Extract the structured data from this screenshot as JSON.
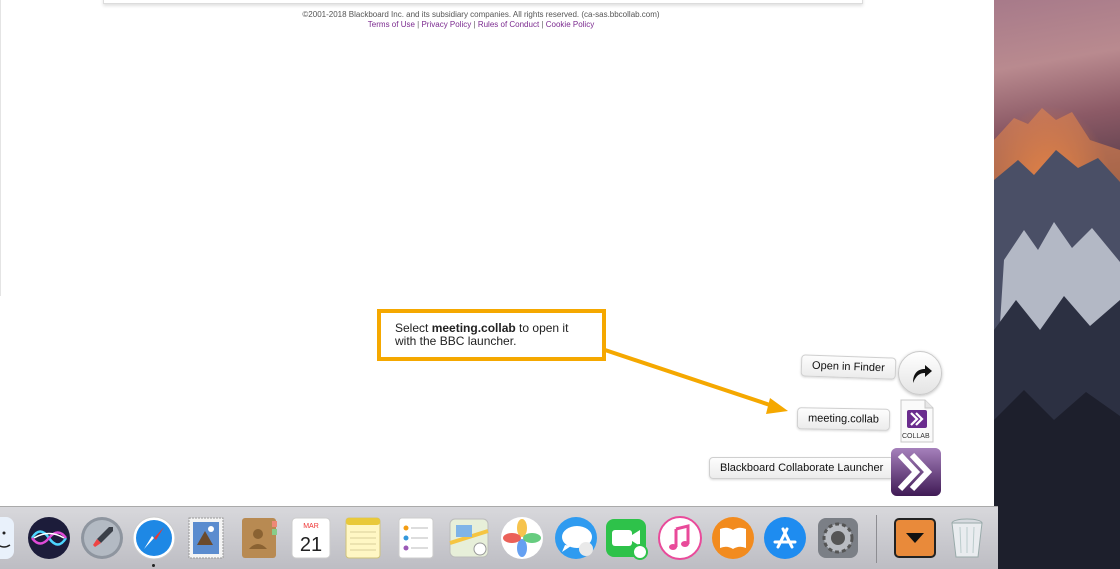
{
  "footer": {
    "copyright": "©2001-2018 Blackboard Inc. and its subsidiary companies. All rights reserved. (ca-sas.bbcollab.com)",
    "links": [
      "Terms of Use",
      "Privacy Policy",
      "Rules of Conduct",
      "Cookie Policy"
    ],
    "separator": "|"
  },
  "callout": {
    "prefix": "Select ",
    "bold": "meeting.collab",
    "suffix": " to open it with the BBC launcher.",
    "border_color": "#f5a800"
  },
  "downloads_stack": {
    "items": [
      {
        "label": "Open in Finder",
        "icon": "arrow-icon"
      },
      {
        "label": "meeting.collab",
        "icon": "collab-file-icon",
        "badge": "COLLAB"
      },
      {
        "label": "Blackboard Collaborate Launcher",
        "icon": "collaborate-launcher-icon"
      }
    ]
  },
  "dock": {
    "apps": [
      {
        "name": "finder",
        "icon": "finder-icon"
      },
      {
        "name": "siri",
        "icon": "siri-icon"
      },
      {
        "name": "launchpad",
        "icon": "rocket-icon"
      },
      {
        "name": "safari",
        "icon": "compass-icon",
        "running": true
      },
      {
        "name": "mail",
        "icon": "stamp-icon"
      },
      {
        "name": "contacts",
        "icon": "contacts-book-icon"
      },
      {
        "name": "calendar",
        "icon": "calendar-icon",
        "month": "MAR",
        "day": "21"
      },
      {
        "name": "notes",
        "icon": "notes-icon"
      },
      {
        "name": "reminders",
        "icon": "reminders-icon"
      },
      {
        "name": "maps",
        "icon": "maps-icon"
      },
      {
        "name": "photos",
        "icon": "photos-flower-icon"
      },
      {
        "name": "messages",
        "icon": "speech-bubble-icon"
      },
      {
        "name": "facetime",
        "icon": "video-camera-icon"
      },
      {
        "name": "itunes",
        "icon": "music-note-icon"
      },
      {
        "name": "ibooks",
        "icon": "open-book-icon"
      },
      {
        "name": "app-store",
        "icon": "app-store-icon"
      },
      {
        "name": "system-preferences",
        "icon": "gear-icon"
      },
      {
        "name": "downloads",
        "icon": "chevron-down-icon"
      },
      {
        "name": "trash",
        "icon": "trash-icon"
      }
    ]
  },
  "colors": {
    "accent": "#f5a800",
    "link": "#7b2a8f",
    "collaborate_purple": "#6a2c8e"
  }
}
